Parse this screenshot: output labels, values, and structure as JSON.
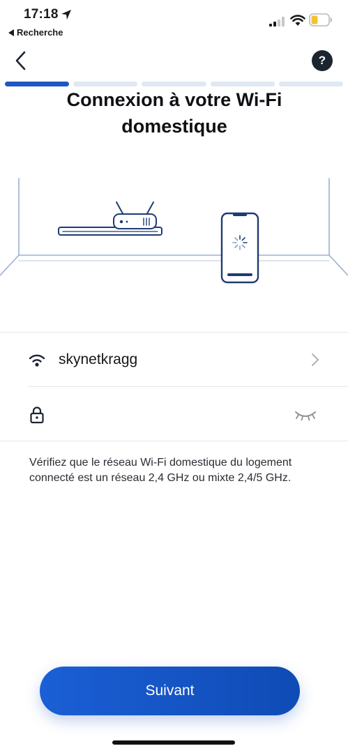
{
  "status_bar": {
    "time": "17:18",
    "back_app_label": "Recherche",
    "battery_color": "#f2c230"
  },
  "nav": {
    "help_label": "?"
  },
  "progress": {
    "total_steps": 5,
    "current_step": 1,
    "active_color": "#1d58c4",
    "inactive_color": "#dfe8f3"
  },
  "title": "Connexion à votre Wi-Fi domestique",
  "network": {
    "ssid": "skynetkragg"
  },
  "password": {
    "value": "",
    "placeholder": ""
  },
  "info_text": "Vérifiez que le réseau Wi-Fi domestique du logement connecté est un réseau 2,4 GHz ou mixte 2,4/5 GHz.",
  "cta": {
    "label": "Suivant",
    "color": "#1b5fd6"
  },
  "icons": {
    "wifi": "wifi-icon",
    "lock": "lock-icon",
    "eye": "eye-closed-icon",
    "chevron": "chevron-right-icon",
    "back": "chevron-left-icon"
  }
}
